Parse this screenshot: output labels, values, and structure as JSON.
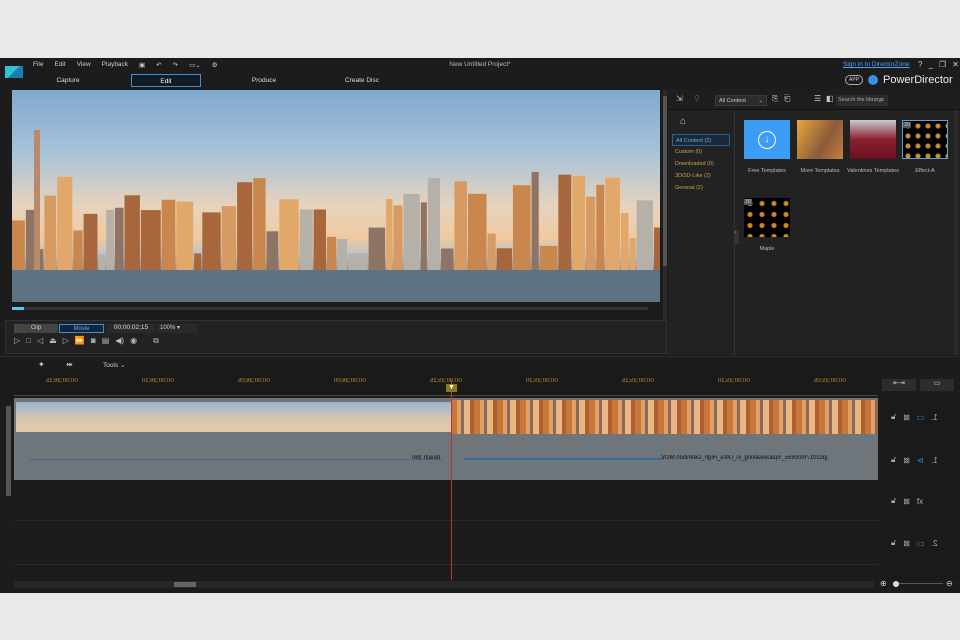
{
  "menu": [
    "File",
    "Edit",
    "View",
    "Playback"
  ],
  "window_title": "New Untitled Project*",
  "signin": "Sign in to DirectorZone",
  "window_buttons": [
    "?",
    "_",
    "❐",
    "✕"
  ],
  "tabs": [
    {
      "label": "Capture"
    },
    {
      "label": "Edit",
      "active": true
    },
    {
      "label": "Produce"
    },
    {
      "label": "Create Disc"
    }
  ],
  "brand": {
    "app_badge": "APP",
    "name": "PowerDirector",
    "accent": "#3a8ee6"
  },
  "player": {
    "clip": "Clip",
    "movie": "Movie",
    "timecode": "00;00;02;15",
    "zoom": "100%"
  },
  "library": {
    "filter": "All Content",
    "search_placeholder": "Search the library",
    "categories": [
      "All Content (2)",
      "Custom (0)",
      "Downloaded (0)",
      "3D/3D-Like (2)",
      "General (2)"
    ],
    "items": [
      {
        "label": "Free Templates"
      },
      {
        "label": "More Templates"
      },
      {
        "label": "Valentines Templates"
      },
      {
        "label": "Effect-A",
        "badge": "3D"
      },
      {
        "label": "Maple",
        "badge": "3D"
      }
    ]
  },
  "timeline": {
    "tools": "Tools",
    "ruler": [
      "00;00;36;15",
      "00;00;36;10",
      "00;00;36;05",
      "00;00;36;00",
      "00;00;35;25",
      "00;00;35;20",
      "00;00;35;15",
      "00;00;35;10",
      "00;00;35;05"
    ],
    "audio_clips": [
      "beach 360",
      "jpc2017m00655_Spacewalking_in_Ultra_High_Definition.MOV"
    ],
    "tracks": [
      "1.",
      "1.",
      "",
      "2."
    ]
  }
}
